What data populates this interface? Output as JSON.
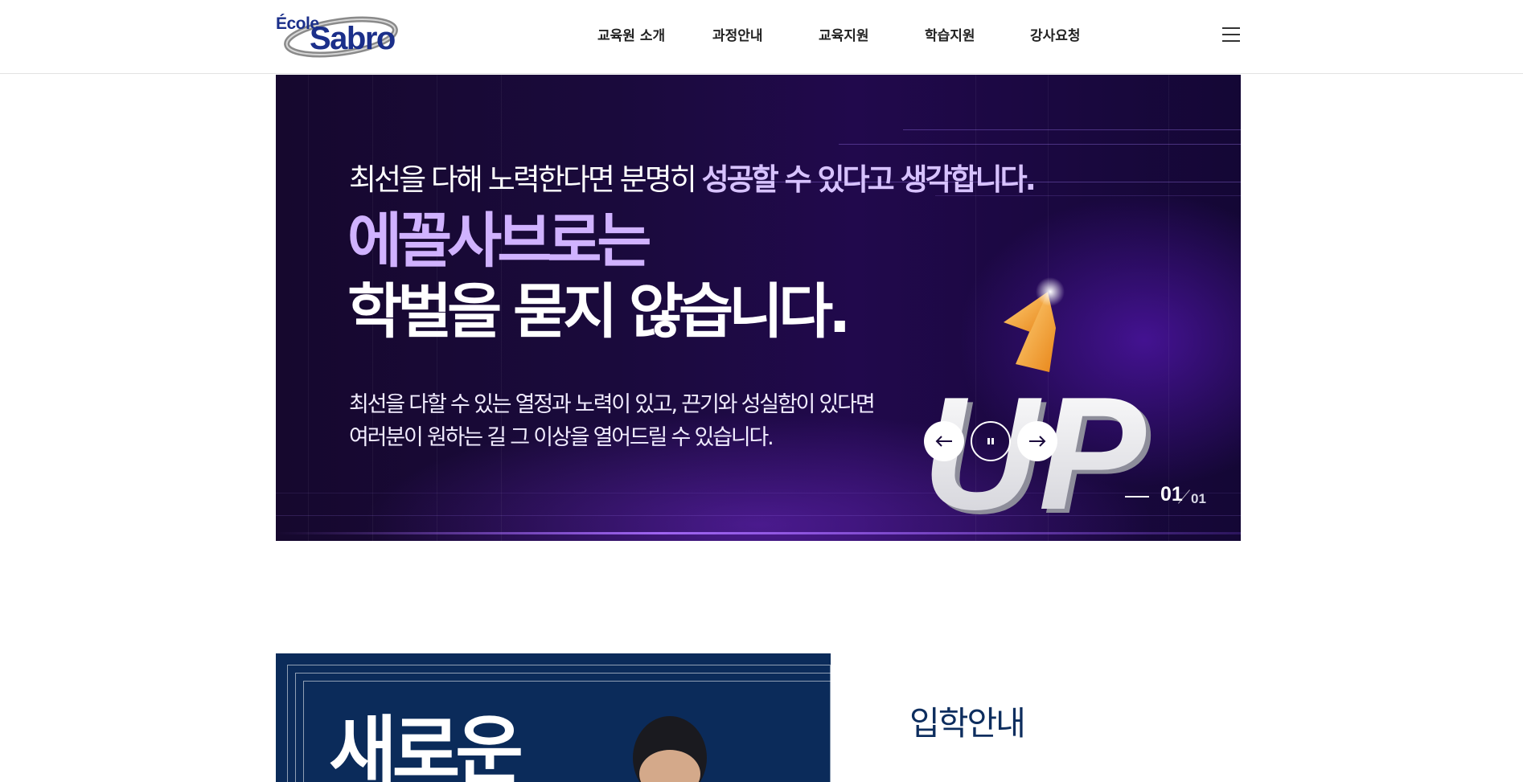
{
  "header": {
    "logo": {
      "top_text": "École",
      "main_text": "Sabro"
    },
    "nav": [
      {
        "label": "교육원 소개"
      },
      {
        "label": "과정안내"
      },
      {
        "label": "교육지원"
      },
      {
        "label": "학습지원"
      },
      {
        "label": "강사요청"
      }
    ],
    "menu_icon": "hamburger-icon"
  },
  "hero": {
    "subtitle_plain": "최선을 다해 노력한다면 분명히 ",
    "subtitle_highlight": "성공할 수 있다고 생각합니다.",
    "title_line1": "에꼴사브로는",
    "title_line2": "학벌을 묻지 않습니다.",
    "desc_line1": "최선을 다할 수 있는 열정과 노력이 있고, 끈기와 성실함이 있다면",
    "desc_line2": "여러분이 원하는 길 그 이상을 열어드릴 수 있습니다.",
    "graphic_text": "UP",
    "controls": {
      "prev_icon": "arrow-left-icon",
      "pause_icon": "pause-icon",
      "next_icon": "arrow-right-icon"
    },
    "pager": {
      "current": "01",
      "total": "01"
    },
    "colors": {
      "highlight": "#d0b2ff",
      "background": "#1a0a3c"
    }
  },
  "promo": {
    "title": "새로운"
  },
  "admission": {
    "title": "입학안내"
  },
  "colors": {
    "brand": "#1b2f8a",
    "navy": "#0b2b5a"
  }
}
